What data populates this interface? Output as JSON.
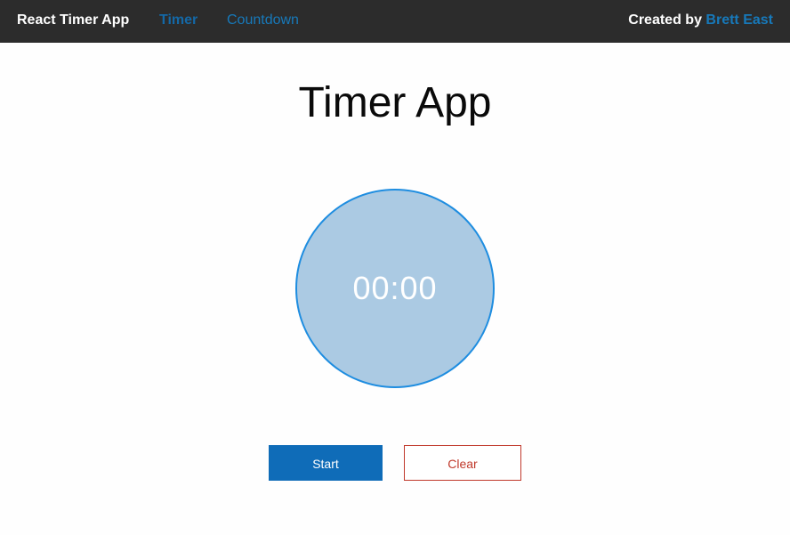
{
  "nav": {
    "brand": "React Timer App",
    "links": [
      {
        "label": "Timer",
        "active": true
      },
      {
        "label": "Countdown",
        "active": false
      }
    ],
    "credit_prefix": "Created by",
    "credit_name": "Brett East"
  },
  "main": {
    "title": "Timer App",
    "clock_display": "00:00",
    "start_label": "Start",
    "clear_label": "Clear"
  },
  "colors": {
    "topbar": "#2c2c2c",
    "link": "#1779ba",
    "clock_fill": "#abcae3",
    "clock_border": "#1e8de0",
    "primary_button": "#0f6cb8",
    "alert": "#c0392b"
  }
}
